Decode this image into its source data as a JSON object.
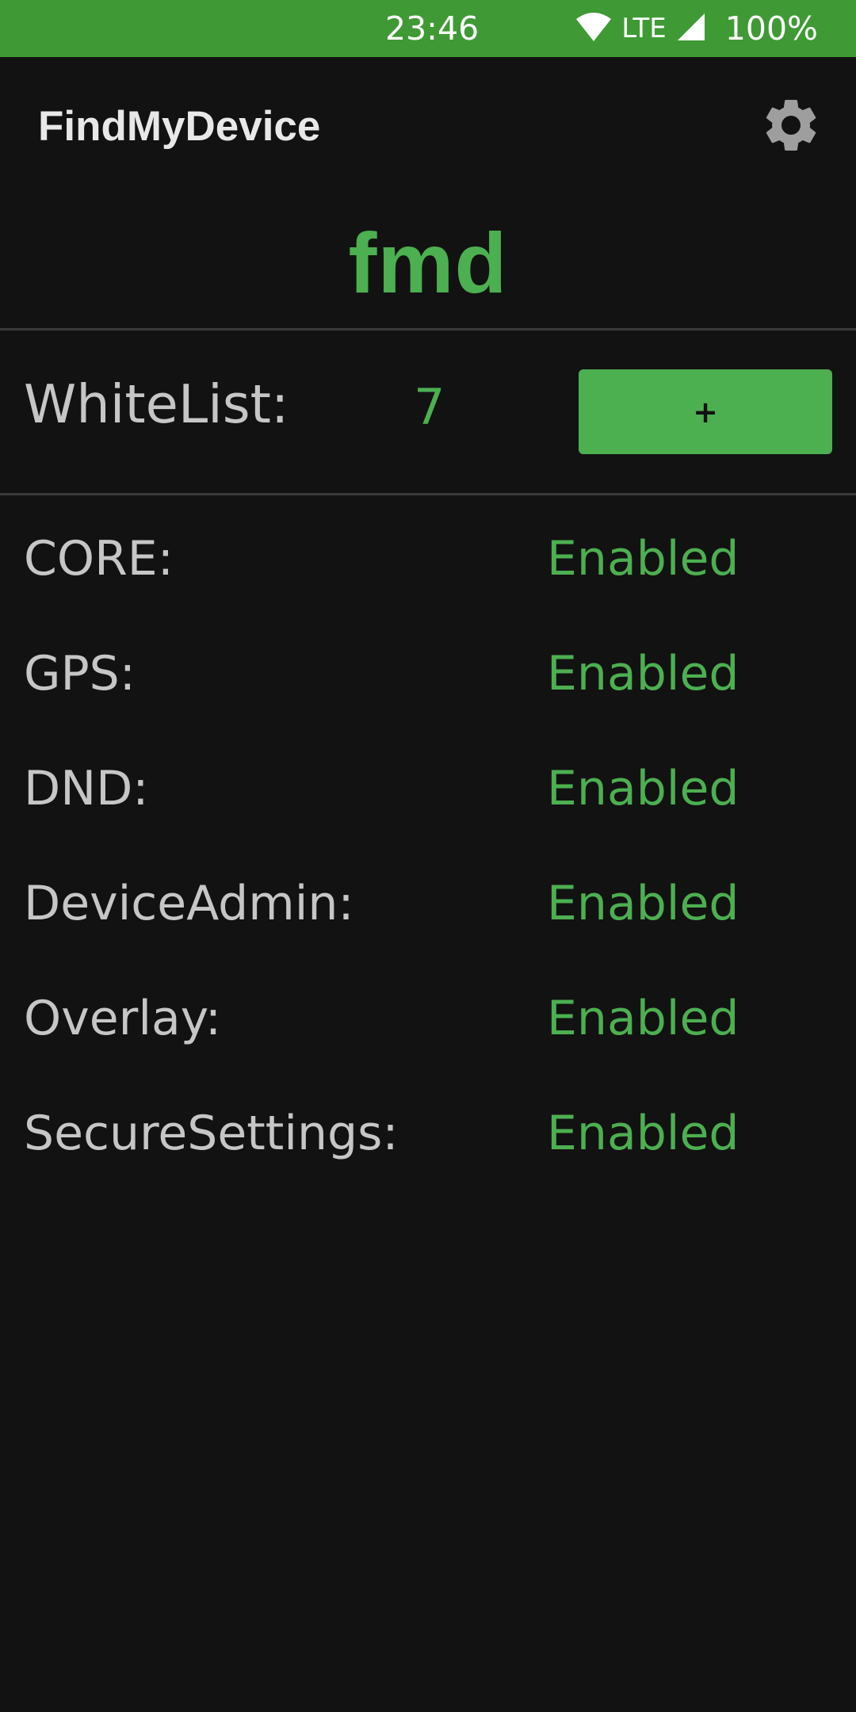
{
  "status_bar": {
    "time": "23:46",
    "network": "LTE",
    "battery": "100%",
    "background_color": "#3f9a35",
    "icons": [
      "wifi-icon",
      "signal-icon"
    ]
  },
  "app_bar": {
    "title": "FindMyDevice",
    "settings_icon": "gear-icon"
  },
  "logo": {
    "text": "fmd",
    "color": "#4caf50"
  },
  "whitelist": {
    "label": "WhiteList:",
    "count": "7",
    "add_button_label": "+"
  },
  "statuses": [
    {
      "label": "CORE:",
      "value": "Enabled"
    },
    {
      "label": "GPS:",
      "value": "Enabled"
    },
    {
      "label": "DND:",
      "value": "Enabled"
    },
    {
      "label": "DeviceAdmin:",
      "value": "Enabled"
    },
    {
      "label": "Overlay:",
      "value": "Enabled"
    },
    {
      "label": "SecureSettings:",
      "value": "Enabled"
    }
  ],
  "colors": {
    "accent": "#4caf50",
    "background": "#121212",
    "label_text": "#c6c6c6"
  }
}
